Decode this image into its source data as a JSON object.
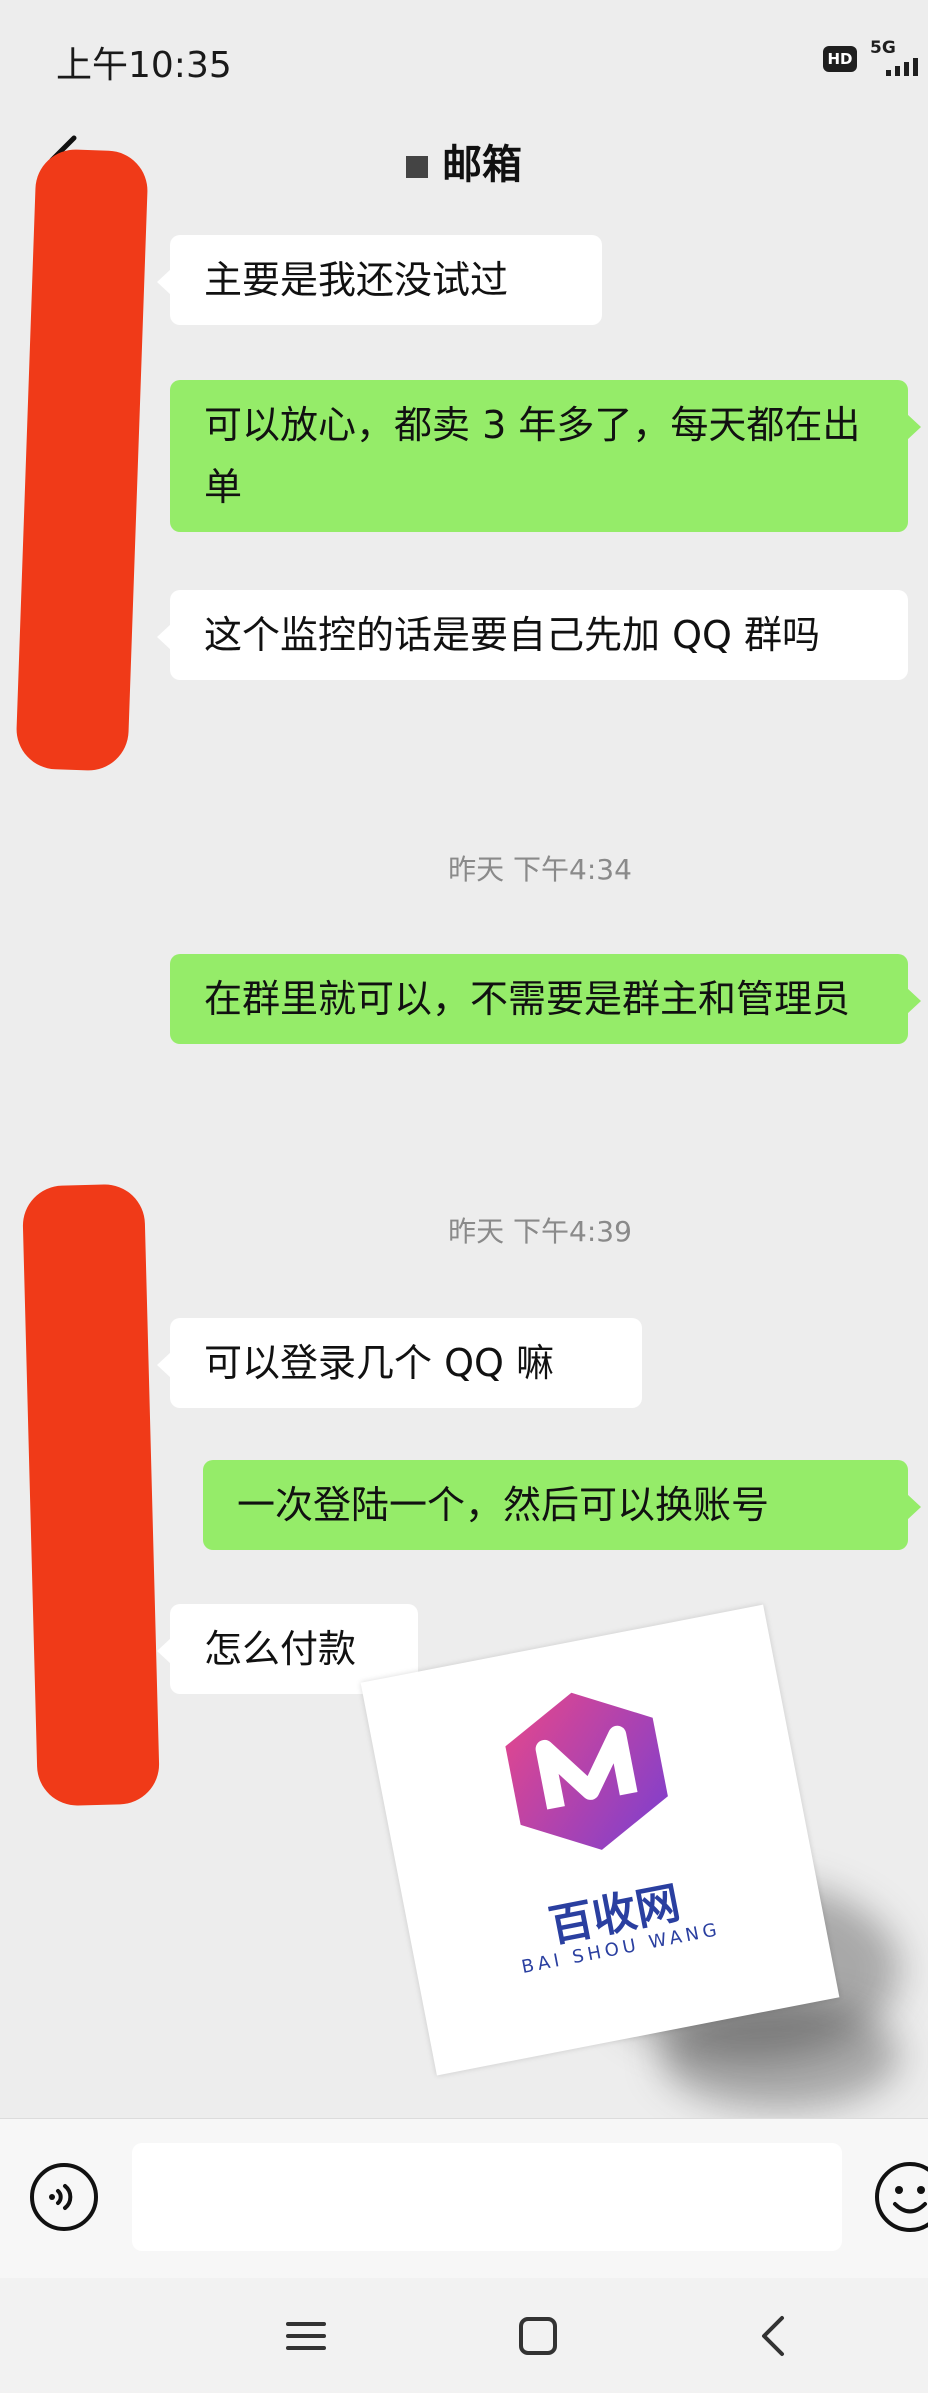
{
  "status_bar": {
    "time": "上午10:35",
    "hd": "HD",
    "network": "5G"
  },
  "nav": {
    "title": "邮箱",
    "back_icon": "chevron-left-icon"
  },
  "messages": [
    {
      "side": "left",
      "text": "主要是我还没试过"
    },
    {
      "side": "right",
      "text": "可以放心，都卖 3 年多了，每天都在出单"
    },
    {
      "side": "left",
      "text": "这个监控的话是要自己先加 QQ 群吗"
    },
    {
      "side": "right",
      "text": "在群里就可以，不需要是群主和管理员"
    },
    {
      "side": "left",
      "text": "可以登录几个 QQ 嘛"
    },
    {
      "side": "right",
      "text": "一次登陆一个，然后可以换账号"
    },
    {
      "side": "left",
      "text": "怎么付款"
    }
  ],
  "timestamps": [
    "昨天 下午4:34",
    "昨天 下午4:39"
  ],
  "watermark": {
    "brand": "百收网",
    "subtitle": "BAI SHOU WANG"
  },
  "input_bar": {
    "value": "",
    "voice_icon": "voice-icon",
    "emoji_icon": "emoji-icon"
  },
  "colors": {
    "background": "#ededed",
    "bubble_self": "#95ec69",
    "bubble_other": "#ffffff",
    "redaction": "#f03a18"
  }
}
